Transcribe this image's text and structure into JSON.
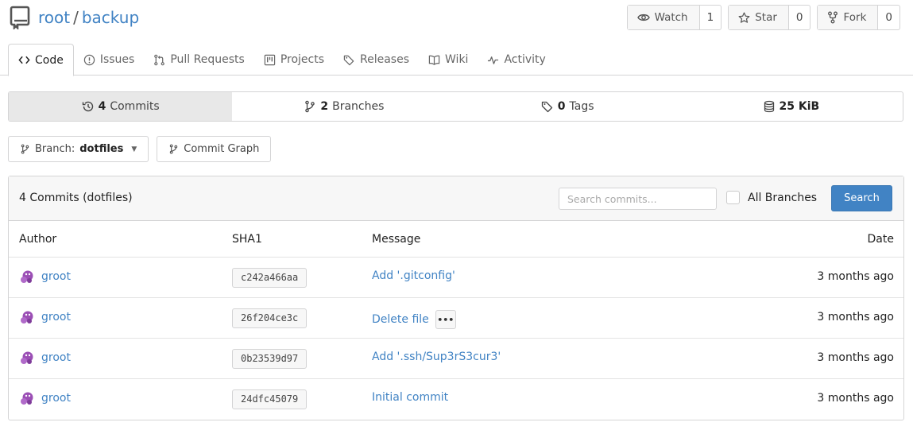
{
  "repo": {
    "owner": "root",
    "separator": "/",
    "name": "backup"
  },
  "actions": [
    {
      "label": "Watch",
      "count": "1"
    },
    {
      "label": "Star",
      "count": "0"
    },
    {
      "label": "Fork",
      "count": "0"
    }
  ],
  "tabs": [
    "Code",
    "Issues",
    "Pull Requests",
    "Projects",
    "Releases",
    "Wiki",
    "Activity"
  ],
  "stats": {
    "commits": {
      "num": "4",
      "label": "Commits"
    },
    "branches": {
      "num": "2",
      "label": "Branches"
    },
    "tags": {
      "num": "0",
      "label": "Tags"
    },
    "size": {
      "num": "25 KiB"
    }
  },
  "branch_button": {
    "prefix": "Branch:",
    "name": "dotfiles"
  },
  "graph_button": "Commit Graph",
  "commits_panel": {
    "title": "4 Commits (dotfiles)",
    "search_placeholder": "Search commits...",
    "all_branches": "All Branches",
    "search_button": "Search",
    "columns": {
      "author": "Author",
      "sha": "SHA1",
      "message": "Message",
      "date": "Date"
    },
    "rows": [
      {
        "author": "groot",
        "sha": "c242a466aa",
        "message": "Add '.gitconfig'",
        "date": "3 months ago",
        "ellipsis": false
      },
      {
        "author": "groot",
        "sha": "26f204ce3c",
        "message": "Delete file",
        "date": "3 months ago",
        "ellipsis": true
      },
      {
        "author": "groot",
        "sha": "0b23539d97",
        "message": "Add '.ssh/Sup3rS3cur3'",
        "date": "3 months ago",
        "ellipsis": false
      },
      {
        "author": "groot",
        "sha": "24dfc45079",
        "message": "Initial commit",
        "date": "3 months ago",
        "ellipsis": false
      }
    ]
  },
  "colors": {
    "link": "#4183c4",
    "primary_button": "#4183c4",
    "avatar": "#9b4fb5"
  }
}
